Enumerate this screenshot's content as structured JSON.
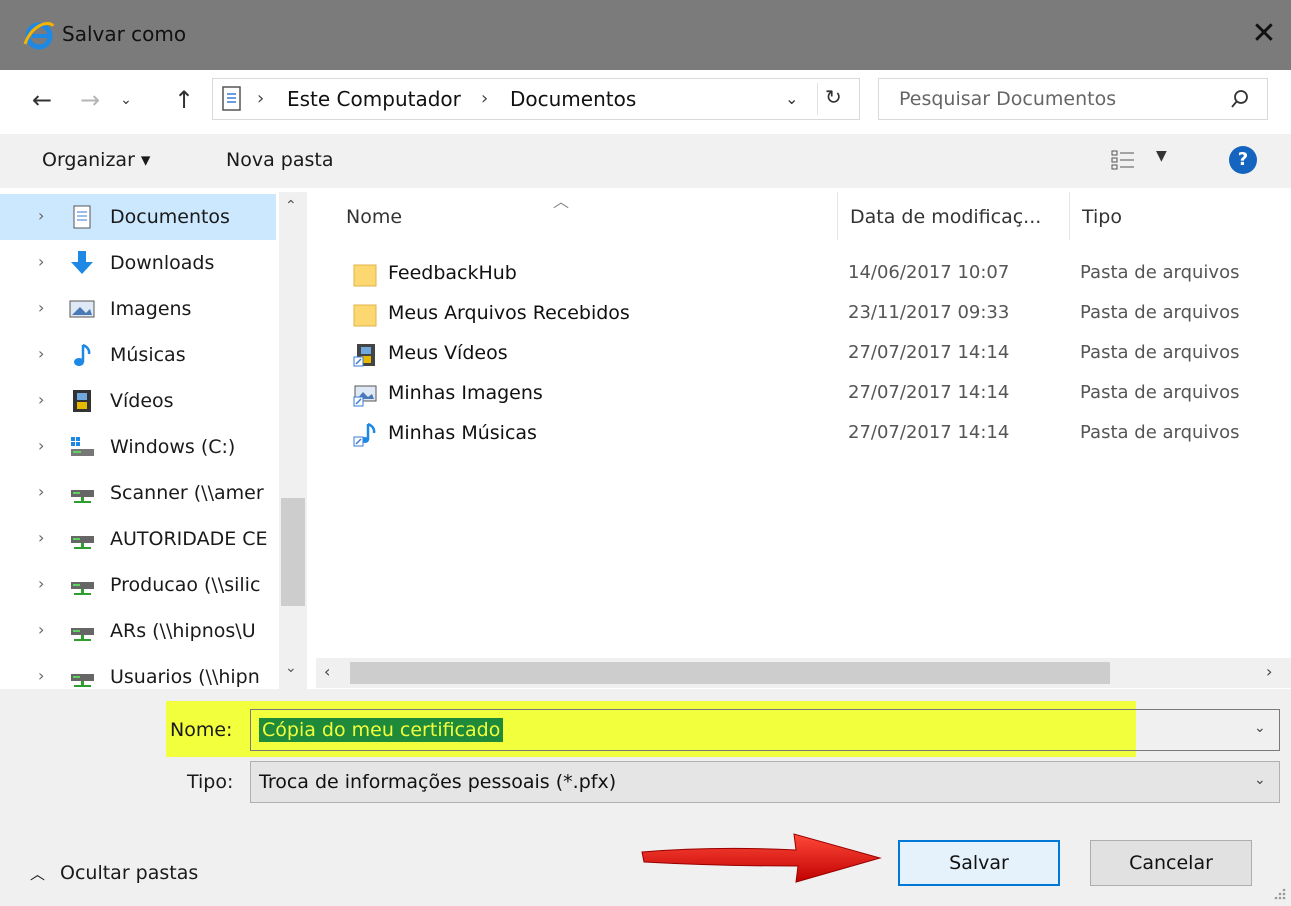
{
  "window": {
    "title": "Salvar como",
    "close_glyph": "✕"
  },
  "address": {
    "crumbs": [
      "Este Computador",
      "Documentos"
    ],
    "separator": "›"
  },
  "search": {
    "placeholder": "Pesquisar Documentos"
  },
  "toolbar": {
    "organize_label": "Organizar ▾",
    "new_folder_label": "Nova pasta",
    "help_label": "?"
  },
  "nav_pane": {
    "items": [
      {
        "label": "Documentos",
        "icon": "document-icon",
        "selected": true
      },
      {
        "label": "Downloads",
        "icon": "download-arrow-icon",
        "selected": false
      },
      {
        "label": "Imagens",
        "icon": "pictures-icon",
        "selected": false
      },
      {
        "label": "Músicas",
        "icon": "music-note-icon",
        "selected": false
      },
      {
        "label": "Vídeos",
        "icon": "film-icon",
        "selected": false
      },
      {
        "label": "Windows (C:)",
        "icon": "drive-icon",
        "selected": false
      },
      {
        "label": "Scanner (\\\\amer",
        "icon": "network-drive-icon",
        "selected": false
      },
      {
        "label": "AUTORIDADE CE",
        "icon": "network-drive-icon",
        "selected": false
      },
      {
        "label": "Producao (\\\\silic",
        "icon": "network-drive-icon",
        "selected": false
      },
      {
        "label": "ARs (\\\\hipnos\\U",
        "icon": "network-drive-icon",
        "selected": false
      },
      {
        "label": "Usuarios (\\\\hipn",
        "icon": "network-drive-icon",
        "selected": false
      }
    ]
  },
  "file_list": {
    "columns": [
      "Nome",
      "Data de modificaç...",
      "Tipo"
    ],
    "rows": [
      {
        "name": "FeedbackHub",
        "date": "14/06/2017 10:07",
        "type": "Pasta de arquivos",
        "icon": "folder-icon"
      },
      {
        "name": "Meus Arquivos Recebidos",
        "date": "23/11/2017 09:33",
        "type": "Pasta de arquivos",
        "icon": "folder-icon"
      },
      {
        "name": "Meus Vídeos",
        "date": "27/07/2017 14:14",
        "type": "Pasta de arquivos",
        "icon": "video-shortcut-icon"
      },
      {
        "name": "Minhas Imagens",
        "date": "27/07/2017 14:14",
        "type": "Pasta de arquivos",
        "icon": "pictures-shortcut-icon"
      },
      {
        "name": "Minhas Músicas",
        "date": "27/07/2017 14:14",
        "type": "Pasta de arquivos",
        "icon": "music-shortcut-icon"
      }
    ]
  },
  "form": {
    "name_label": "Nome:",
    "name_value": "Cópia do meu certificado",
    "type_label": "Tipo:",
    "type_value": "Troca de informações pessoais (*.pfx)"
  },
  "footer": {
    "hide_folders_label": "Ocultar pastas",
    "save_label": "Salvar",
    "cancel_label": "Cancelar"
  },
  "colors": {
    "highlight": "#f2ff3c",
    "selection": "#1f8a3a",
    "arrow": "#e01010",
    "accent": "#0078d7"
  }
}
